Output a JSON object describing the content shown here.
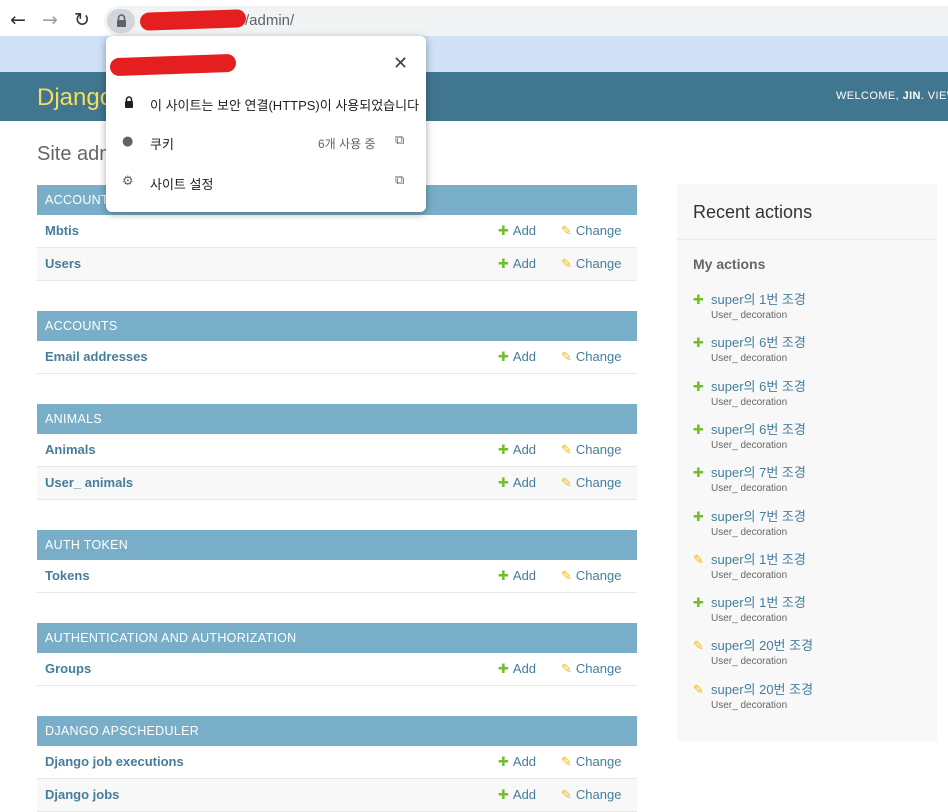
{
  "browser": {
    "url_path": "/admin/",
    "back_icon": "←",
    "forward_icon": "→",
    "reload_icon": "↻",
    "lock_icon": "🔒"
  },
  "header": {
    "branding": "Django administration",
    "welcome": "WELCOME, ",
    "username": "JIN",
    "after_user": ". VIEW"
  },
  "page": {
    "title": "Site administration"
  },
  "labels": {
    "add": "Add",
    "change": "Change",
    "plus": "✚",
    "pencil": "✎"
  },
  "modules": [
    {
      "caption": "ACCOUNTS",
      "rows": [
        "Mbtis",
        "Users"
      ]
    },
    {
      "caption": "ACCOUNTS",
      "rows": [
        "Email addresses"
      ]
    },
    {
      "caption": "ANIMALS",
      "rows": [
        "Animals",
        "User_ animals"
      ]
    },
    {
      "caption": "AUTH TOKEN",
      "rows": [
        "Tokens"
      ]
    },
    {
      "caption": "AUTHENTICATION AND AUTHORIZATION",
      "rows": [
        "Groups"
      ]
    },
    {
      "caption": "DJANGO APSCHEDULER",
      "rows": [
        "Django job executions",
        "Django jobs"
      ]
    }
  ],
  "recent": {
    "title": "Recent actions",
    "subtitle": "My actions",
    "items": [
      {
        "type": "add",
        "text": "super의 1번 조경",
        "model": "User_ decoration"
      },
      {
        "type": "add",
        "text": "super의 6번 조경",
        "model": "User_ decoration"
      },
      {
        "type": "add",
        "text": "super의 6번 조경",
        "model": "User_ decoration"
      },
      {
        "type": "add",
        "text": "super의 6번 조경",
        "model": "User_ decoration"
      },
      {
        "type": "add",
        "text": "super의 7번 조경",
        "model": "User_ decoration"
      },
      {
        "type": "add",
        "text": "super의 7번 조경",
        "model": "User_ decoration"
      },
      {
        "type": "change",
        "text": "super의 1번 조경",
        "model": "User_ decoration"
      },
      {
        "type": "add",
        "text": "super의 1번 조경",
        "model": "User_ decoration"
      },
      {
        "type": "change",
        "text": "super의 20번 조경",
        "model": "User_ decoration"
      },
      {
        "type": "change",
        "text": "super의 20번 조경",
        "model": "User_ decoration"
      }
    ]
  },
  "popup": {
    "close_icon": "✕",
    "secure_text": "이 사이트는 보안 연결(HTTPS)이 사용되었습니다",
    "cookies_label": "쿠키",
    "cookies_count": "6개 사용 중",
    "settings_label": "사이트 설정",
    "lock_icon": "🔒",
    "cookie_icon": "●",
    "gear_icon": "⚙",
    "external_icon": "⧉"
  },
  "colors": {
    "header_bg": "#417690",
    "branding": "#f5dd5d",
    "caption_bg": "#79aec8",
    "link": "#447e9b",
    "add_green": "#70bf2b",
    "change_yellow": "#efb80b"
  }
}
